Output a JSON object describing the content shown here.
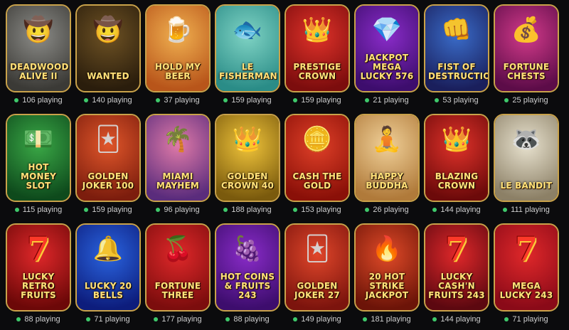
{
  "status_dot_color": "#3ec96b",
  "games": [
    {
      "title": "Deadwood Alive II",
      "players": "106 playing",
      "bg": [
        "#8c8c88",
        "#3b3a36"
      ],
      "icon": "cowboy-icon",
      "glyph": "🤠"
    },
    {
      "title": "Wanted",
      "players": "140 playing",
      "bg": [
        "#6e5224",
        "#2a1d0c"
      ],
      "icon": "cowboy-hat-icon",
      "glyph": "🤠"
    },
    {
      "title": "Hold My Beer",
      "players": "37 playing",
      "bg": [
        "#f0b050",
        "#b8551a"
      ],
      "icon": "beer-icon",
      "glyph": "🍺"
    },
    {
      "title": "Le Fisherman",
      "players": "159 playing",
      "bg": [
        "#7fd3c4",
        "#2a8c87"
      ],
      "icon": "fish-icon",
      "glyph": "🐟"
    },
    {
      "title": "Prestige Crown",
      "players": "159 playing",
      "bg": [
        "#e0322a",
        "#7c0d0d"
      ],
      "icon": "crown-icon",
      "glyph": "👑"
    },
    {
      "title": "Jackpot Mega Lucky 576",
      "players": "21 playing",
      "bg": [
        "#8a2cc9",
        "#3d0d6d"
      ],
      "icon": "diamond-icon",
      "glyph": "💎"
    },
    {
      "title": "Fist of Destruction",
      "players": "53 playing",
      "bg": [
        "#3a6cc9",
        "#1a1f5c"
      ],
      "icon": "fist-icon",
      "glyph": "👊"
    },
    {
      "title": "Fortune Chests",
      "players": "25 playing",
      "bg": [
        "#d23a8a",
        "#5c0c48"
      ],
      "icon": "chest-icon",
      "glyph": "💰"
    },
    {
      "title": "Hot Money Slot",
      "players": "115 playing",
      "bg": [
        "#3aa846",
        "#0e4a1c"
      ],
      "icon": "money-icon",
      "glyph": "💵"
    },
    {
      "title": "Golden Joker 100",
      "players": "159 playing",
      "bg": [
        "#e0562a",
        "#7c1d0d"
      ],
      "icon": "joker-icon",
      "glyph": "🃏"
    },
    {
      "title": "Miami Mayhem",
      "players": "96 playing",
      "bg": [
        "#e07aa8",
        "#5a2c7c"
      ],
      "icon": "palm-icon",
      "glyph": "🌴"
    },
    {
      "title": "Golden Crown 40",
      "players": "188 playing",
      "bg": [
        "#f0c43a",
        "#7a5a0d"
      ],
      "icon": "crown-icon",
      "glyph": "👑"
    },
    {
      "title": "Cash the Gold",
      "players": "153 playing",
      "bg": [
        "#e04028",
        "#8a1008"
      ],
      "icon": "coin-icon",
      "glyph": "🪙"
    },
    {
      "title": "Happy Buddha",
      "players": "26 playing",
      "bg": [
        "#f0d098",
        "#b07a3a"
      ],
      "icon": "buddha-icon",
      "glyph": "🧘"
    },
    {
      "title": "Blazing Crown",
      "players": "144 playing",
      "bg": [
        "#e0322a",
        "#6c0a0a"
      ],
      "icon": "crown-icon",
      "glyph": "👑"
    },
    {
      "title": "Le Bandit",
      "players": "111 playing",
      "bg": [
        "#e8e2cf",
        "#8c8066"
      ],
      "icon": "raccoon-icon",
      "glyph": "🦝"
    },
    {
      "title": "Lucky Retro Fruits",
      "players": "88 playing",
      "bg": [
        "#e0282a",
        "#6c0808"
      ],
      "icon": "seven-icon",
      "glyph": "7"
    },
    {
      "title": "Lucky 20 Bells",
      "players": "71 playing",
      "bg": [
        "#2a64e0",
        "#0d1d7c"
      ],
      "icon": "bell-icon",
      "glyph": "🔔"
    },
    {
      "title": "Fortune Three",
      "players": "177 playing",
      "bg": [
        "#e0282a",
        "#7c0d0d"
      ],
      "icon": "cherry-icon",
      "glyph": "🍒"
    },
    {
      "title": "Hot Coins & Fruits 243",
      "players": "88 playing",
      "bg": [
        "#8a2cc9",
        "#3d0d6d"
      ],
      "icon": "grapes-icon",
      "glyph": "🍇"
    },
    {
      "title": "Golden Joker 27",
      "players": "149 playing",
      "bg": [
        "#e0462a",
        "#7c140d"
      ],
      "icon": "joker-icon",
      "glyph": "🃏"
    },
    {
      "title": "20 Hot Strike Jackpot",
      "players": "181 playing",
      "bg": [
        "#e04a28",
        "#6c1408"
      ],
      "icon": "flame-icon",
      "glyph": "🔥"
    },
    {
      "title": "Lucky Cash'n Fruits 243",
      "players": "144 playing",
      "bg": [
        "#e0282a",
        "#5c0810"
      ],
      "icon": "seven-icon",
      "glyph": "7"
    },
    {
      "title": "Mega Lucky 243",
      "players": "71 playing",
      "bg": [
        "#e0282a",
        "#8a0a18"
      ],
      "icon": "seven-icon",
      "glyph": "7"
    }
  ]
}
